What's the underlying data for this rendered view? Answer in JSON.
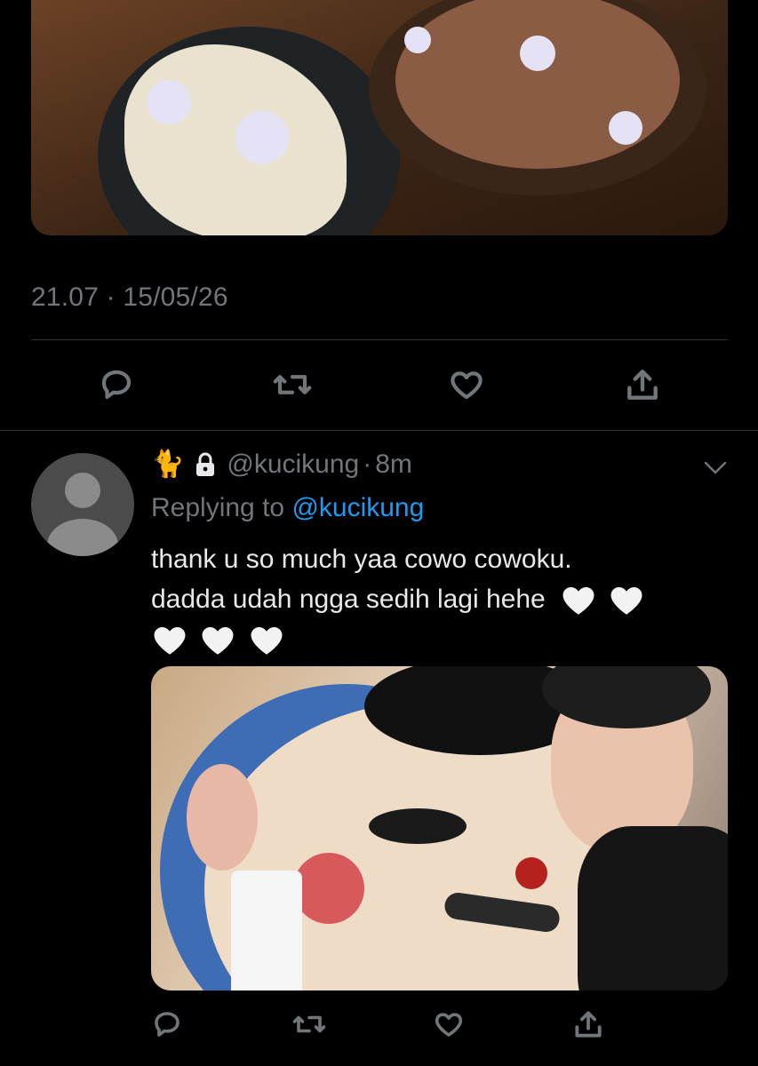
{
  "main_tweet": {
    "timestamp": "21.07 · 15/05/26",
    "actions": {
      "reply_icon": "speech-bubble-icon",
      "retweet_icon": "retweet-icon",
      "like_icon": "heart-icon",
      "share_icon": "share-upload-icon"
    }
  },
  "reply": {
    "emoji": "🐈",
    "handle": "@kucikung",
    "separator": "·",
    "time": "8m",
    "replying_prefix": "Replying to",
    "replying_to": "@kucikung",
    "text_line1": "thank u so much yaa cowo cowoku.",
    "text_line2": "dadda udah ngga sedih lagi hehe",
    "hearts": "🤍🤍🤍🤍🤍",
    "heart_count_inline": 2,
    "heart_count_next_line": 3
  },
  "colors": {
    "background": "#000000",
    "text_primary": "#e7e9ea",
    "text_secondary": "#71767b",
    "link": "#1d9bf0",
    "divider": "#2f3336"
  }
}
